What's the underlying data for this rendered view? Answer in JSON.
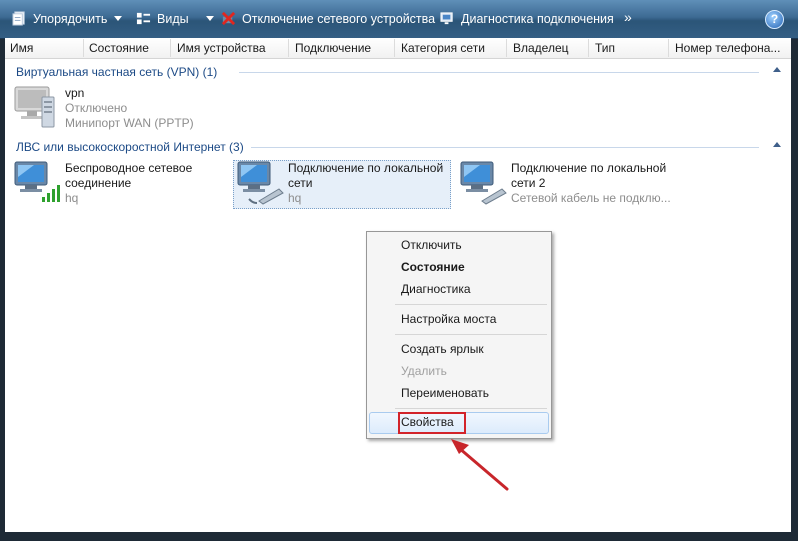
{
  "toolbar": {
    "organize_label": "Упорядочить",
    "views_label": "Виды",
    "disable_label": "Отключение сетевого устройства",
    "diagnose_label": "Диагностика подключения",
    "more_label": "»",
    "help_label": "?"
  },
  "columns": [
    "Имя",
    "Состояние",
    "Имя устройства",
    "Подключение",
    "Категория сети",
    "Владелец",
    "Тип",
    "Номер телефона..."
  ],
  "groups": [
    {
      "title": "Виртуальная частная сеть (VPN) (1)",
      "items": [
        {
          "name": "vpn",
          "status": "Отключено",
          "device": "Минипорт WAN (PPTP)"
        }
      ]
    },
    {
      "title": "ЛВС или высокоскоростной Интернет (3)",
      "items": [
        {
          "name_line1": "Беспроводное сетевое",
          "name_line2": "соединение",
          "sub": "hq"
        },
        {
          "name_line1": "Подключение по локальной",
          "name_line2": "сети",
          "sub": "hq"
        },
        {
          "name_line1": "Подключение по локальной",
          "name_line2": "сети 2",
          "sub": "Сетевой кабель не подклю..."
        }
      ]
    }
  ],
  "context_menu": {
    "items": [
      "Отключить",
      "Состояние",
      "Диагностика",
      "Настройка моста",
      "Создать ярлык",
      "Удалить",
      "Переименовать",
      "Свойства"
    ],
    "default_item": "Состояние",
    "disabled_item": "Удалить",
    "highlighted_item": "Свойства"
  },
  "colors": {
    "toolbar": "#3d6a93",
    "group_title": "#1c4a86",
    "annotation": "#d2232a"
  }
}
